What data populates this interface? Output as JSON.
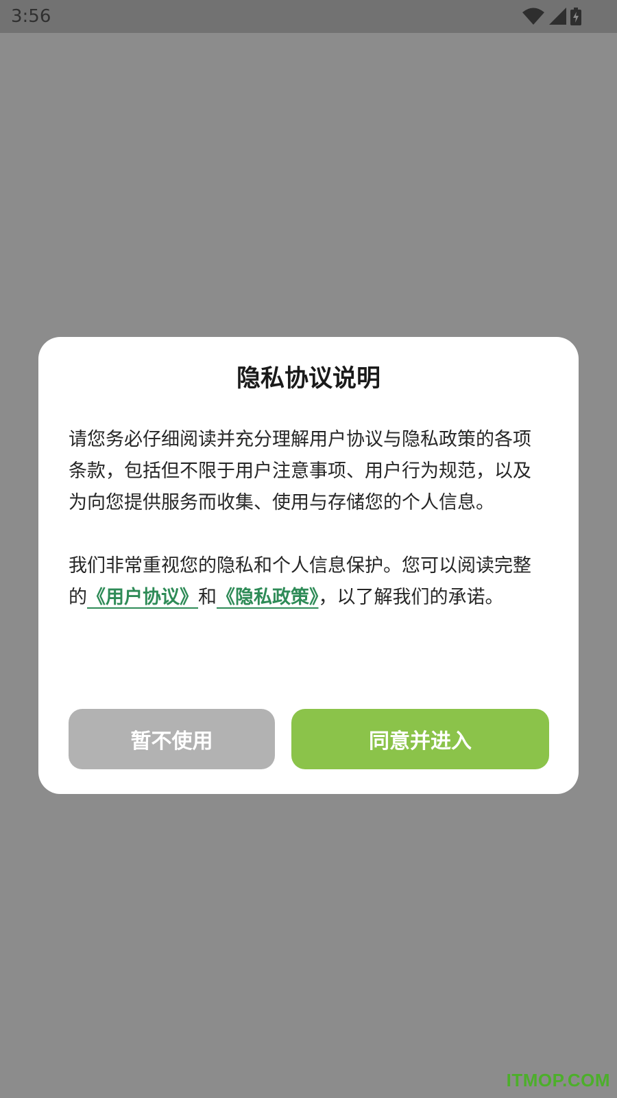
{
  "status_bar": {
    "time": "3:56",
    "icons": [
      "wifi-icon",
      "signal-icon",
      "battery-charging-icon"
    ]
  },
  "dialog": {
    "title": "隐私协议说明",
    "paragraph1": "请您务必仔细阅读并充分理解用户协议与隐私政策的各项条款，包括但不限于用户注意事项、用户行为规范，以及为向您提供服务而收集、使用与存储您的个人信息。",
    "paragraph2": {
      "before": "我们非常重视您的隐私和个人信息保护。您可以阅读完整的",
      "link_user_agreement": "《用户协议》",
      "middle": "和",
      "link_privacy_policy": "《隐私政策》",
      "after": "，以了解我们的承诺。"
    },
    "cancel_button": "暂不使用",
    "agree_button": "同意并进入"
  },
  "watermark": "ITMOP.COM",
  "colors": {
    "overlay": "#8c8c8c",
    "link": "#2e8b57",
    "agree": "#8bc34a",
    "cancel": "#b2b2b2"
  }
}
